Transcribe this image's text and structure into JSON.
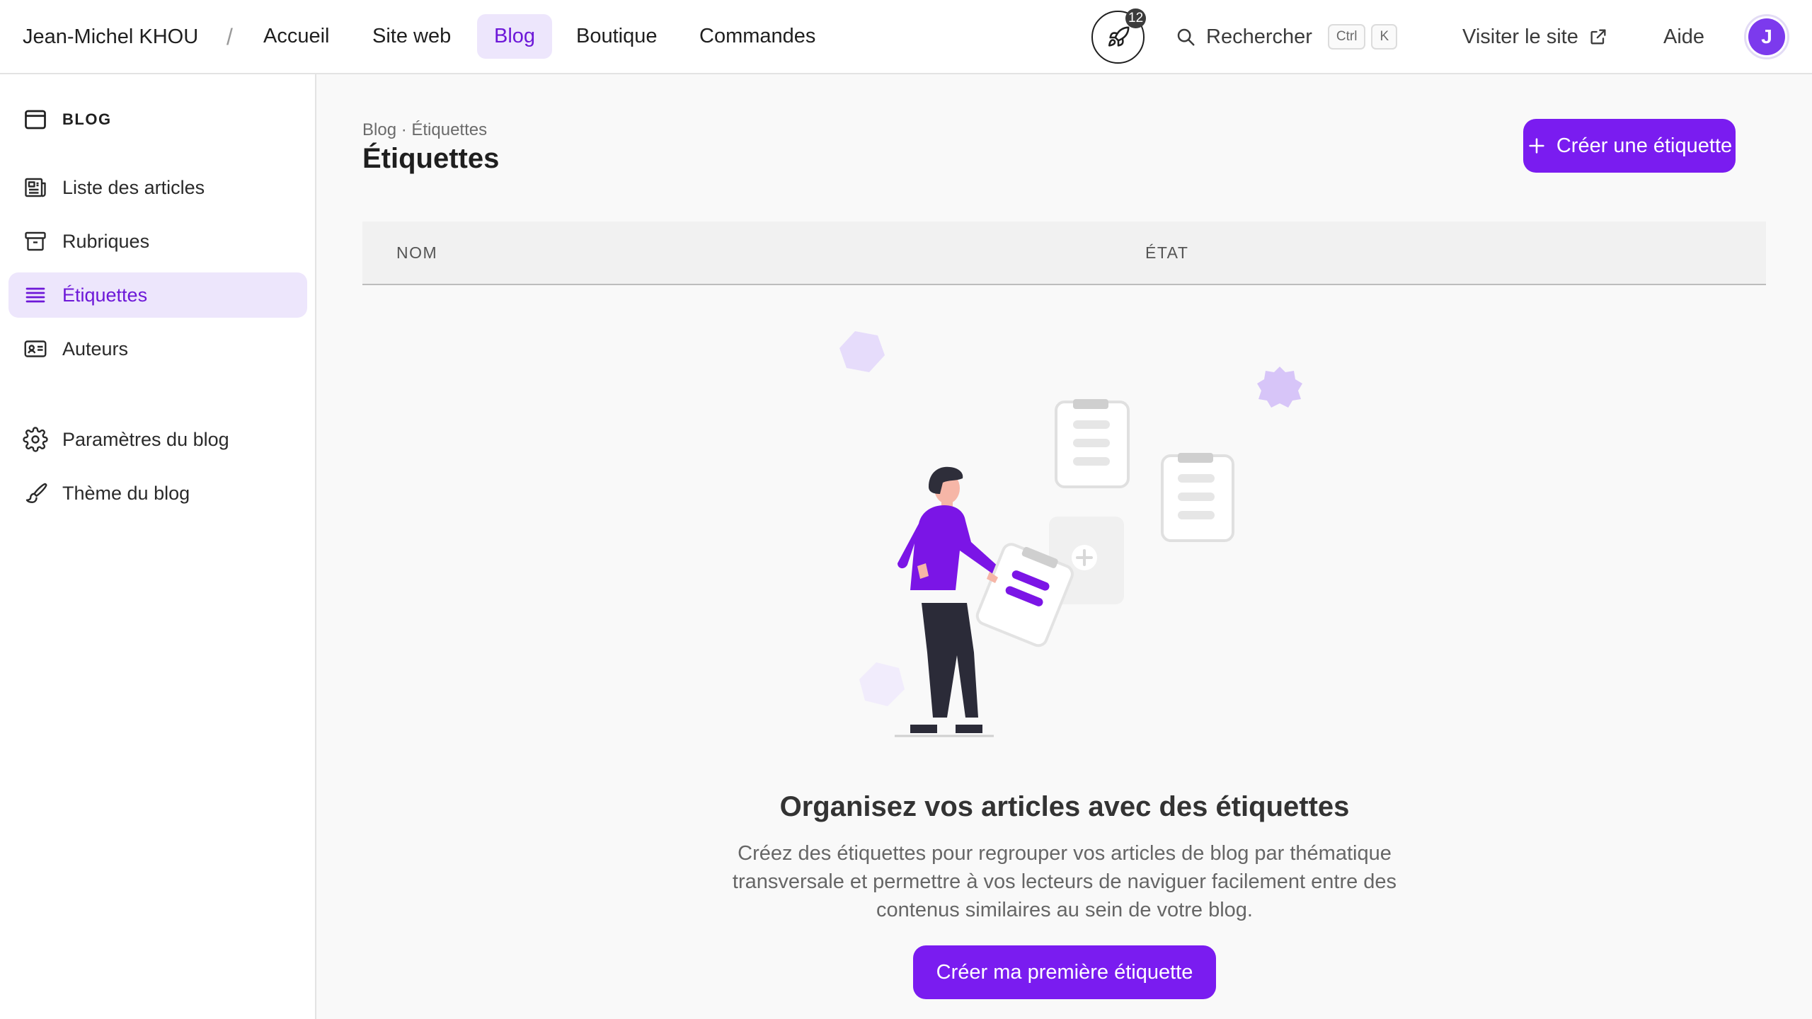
{
  "header": {
    "user_name": "Jean-Michel KHOU",
    "separator": "/",
    "nav": [
      {
        "label": "Accueil"
      },
      {
        "label": "Site web"
      },
      {
        "label": "Blog"
      },
      {
        "label": "Boutique"
      },
      {
        "label": "Commandes"
      }
    ],
    "active_nav": "Blog",
    "notifications_count": "12",
    "search_label": "Rechercher",
    "shortcut_keys": [
      "Ctrl",
      "K"
    ],
    "visit_label": "Visiter le site",
    "help_label": "Aide",
    "avatar_initial": "J"
  },
  "sidebar": {
    "section_title": "BLOG",
    "items": [
      {
        "label": "Liste des articles",
        "icon": "newspaper-icon"
      },
      {
        "label": "Rubriques",
        "icon": "archive-box-icon"
      },
      {
        "label": "Étiquettes",
        "icon": "list-lines-icon"
      },
      {
        "label": "Auteurs",
        "icon": "id-card-icon"
      },
      {
        "label": "Paramètres du blog",
        "icon": "gear-icon"
      },
      {
        "label": "Thème du blog",
        "icon": "paintbrush-icon"
      }
    ],
    "active_item": "Étiquettes"
  },
  "main": {
    "breadcrumb": "Blog · Étiquettes",
    "title": "Étiquettes",
    "create_button": "Créer une étiquette",
    "table": {
      "columns": [
        "NOM",
        "ÉTAT"
      ]
    },
    "empty_state": {
      "title": "Organisez vos articles avec des étiquettes",
      "description": "Créez des étiquettes pour regrouper vos articles de blog par thématique transversale et permettre à vos lecteurs de naviguer facilement entre des contenus similaires au sein de votre blog.",
      "cta": "Créer ma première étiquette"
    }
  },
  "colors": {
    "accent": "#7a1cf0",
    "accent_light": "#ede6fc",
    "active_text": "#6d18d8"
  }
}
